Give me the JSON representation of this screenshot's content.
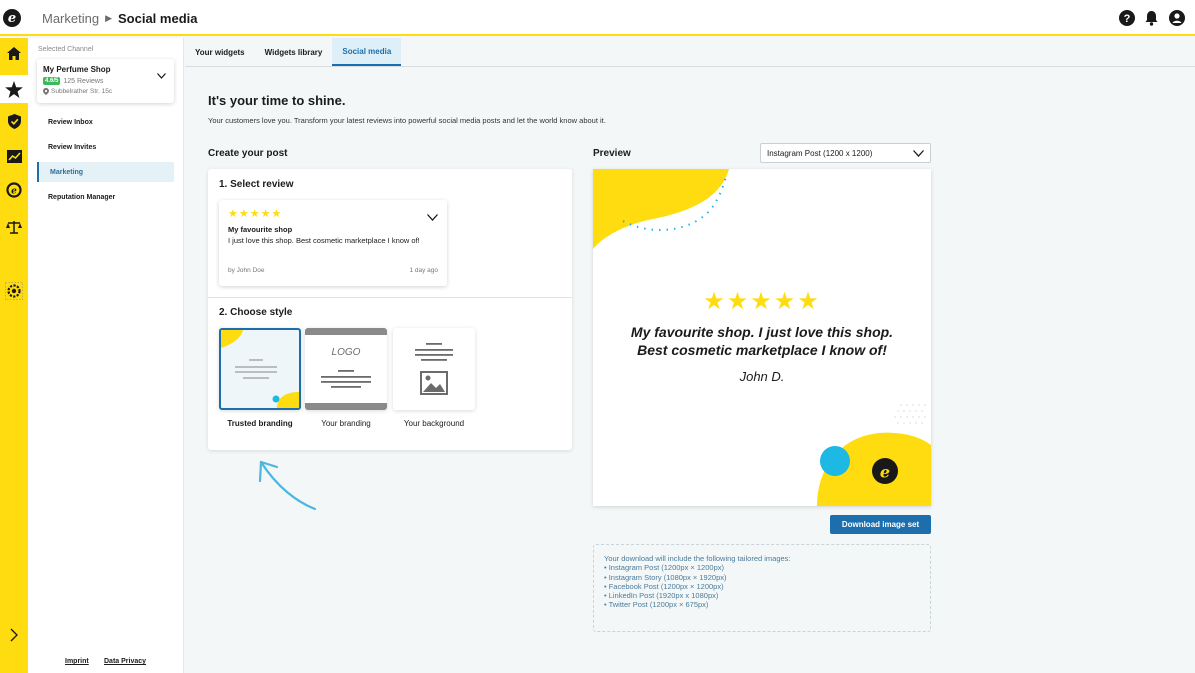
{
  "header": {
    "breadcrumb": [
      "Marketing",
      "Social media"
    ],
    "icons": [
      "help-icon",
      "bell-icon",
      "user-icon"
    ]
  },
  "rail": {
    "icons": [
      "home-icon",
      "star-icon",
      "shield-icon",
      "chart-icon",
      "trustpilot-icon",
      "scales-icon",
      "settings-icon"
    ],
    "active": "star-icon"
  },
  "sidebar": {
    "selected_label": "Selected Channel",
    "channel": {
      "name": "My Perfume Shop",
      "rating": "4.6/5",
      "reviews": "125 Reviews",
      "address": "Subbelrather Str. 15c"
    },
    "items": [
      {
        "label": "Review Inbox"
      },
      {
        "label": "Review Invites"
      },
      {
        "label": "Marketing"
      },
      {
        "label": "Reputation Manager"
      }
    ],
    "active_item": "Marketing",
    "footer": [
      "Imprint",
      "Data Privacy"
    ]
  },
  "tabs": [
    {
      "label": "Your widgets"
    },
    {
      "label": "Widgets library"
    },
    {
      "label": "Social media"
    }
  ],
  "active_tab": "Social media",
  "main": {
    "headline": "It's your time to shine.",
    "subline": "Your customers love you. Transform your latest reviews into powerful social media posts and let the world know about it.",
    "create_title": "Create your post",
    "step1_title": "1. Select review",
    "review": {
      "stars": "★★★★★",
      "title": "My favourite shop",
      "body": "I just love this shop. Best cosmetic marketplace I know of!",
      "author": "by John Doe",
      "age": "1 day ago"
    },
    "step2_title": "2. Choose style",
    "styles": [
      {
        "label": "Trusted branding",
        "selected": true
      },
      {
        "label": "Your branding",
        "logo_text": "LOGO"
      },
      {
        "label": "Your background"
      }
    ]
  },
  "preview": {
    "title": "Preview",
    "format": "Instagram Post (1200 x 1200)",
    "stars": "★★★★★",
    "quote": "My favourite shop. I just love this shop. Best cosmetic marketplace I know of!",
    "author": "John D.",
    "download_label": "Download image set",
    "info_title": "Your download will include the following tailored images:",
    "info_items": [
      "• Instagram Post (1200px × 1200px)",
      "• Instagram Story (1080px × 1920px)",
      "• Facebook Post (1200px × 1200px)",
      "• LinkedIn Post (1920px x 1080px)",
      "• Twitter Post (1200px × 675px)"
    ]
  },
  "colors": {
    "brand_yellow": "#ffdc0f",
    "accent_blue": "#1c6fac",
    "accent_cyan": "#1eb8e4",
    "badge_green": "#3bba5c"
  }
}
